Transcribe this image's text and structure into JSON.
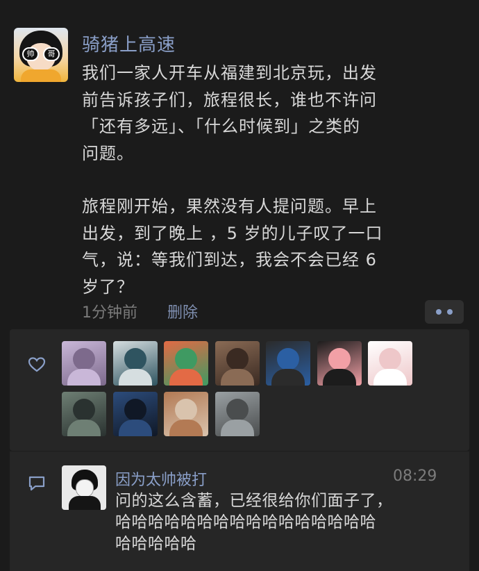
{
  "post": {
    "username": "骑猪上高速",
    "avatar_badges": [
      "帅",
      "哥"
    ],
    "paragraphs": [
      "我们一家人开车从福建到北京玩，出发",
      "前告诉孩子们，旅程很长，谁也不许问",
      "「还有多远」、「什么时候到」之类的",
      "问题。",
      "",
      "旅程刚开始，果然没有人提问题。早上",
      "出发，到了晚上 ，5 岁的儿子叹了一口",
      "气，说：等我们到达，我会不会已经 6",
      "岁了？"
    ],
    "time": "1分钟前",
    "delete_label": "删除",
    "more_icon": "more-dots-icon"
  },
  "likes": {
    "icon": "heart-icon",
    "avatars": [
      {
        "c1": "#c9b7d8",
        "c2": "#7d6a8c"
      },
      {
        "c1": "#d6dee0",
        "c2": "#2f5460"
      },
      {
        "c1": "#e36a45",
        "c2": "#3f9a62"
      },
      {
        "c1": "#8a6b55",
        "c2": "#3a2a22"
      },
      {
        "c1": "#2b2b2b",
        "c2": "#2b5fa3"
      },
      {
        "c1": "#1c1c1c",
        "c2": "#f2a0a6"
      },
      {
        "c1": "#ffffff",
        "c2": "#eec7c9"
      },
      {
        "c1": "#6e7f74",
        "c2": "#2a3230"
      },
      {
        "c1": "#2c4c7c",
        "c2": "#101826"
      },
      {
        "c1": "#b37a54",
        "c2": "#d9c3ad"
      },
      {
        "c1": "#9aa0a3",
        "c2": "#4a4d4e"
      }
    ]
  },
  "comment": {
    "icon": "comment-icon",
    "name": "因为太帅被打",
    "time": "08:29",
    "lines": [
      "问的这么含蓄，已经很给你们面子了，",
      "哈哈哈哈哈哈哈哈哈哈哈哈哈哈哈哈",
      "哈哈哈哈哈"
    ]
  }
}
